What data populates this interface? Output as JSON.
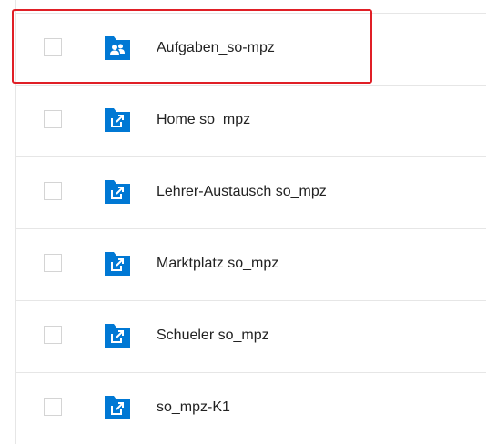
{
  "files": {
    "items": [
      {
        "name": "Aufgaben_so-mpz",
        "icon": "shared-folder-icon",
        "selected": false
      },
      {
        "name": "Home so_mpz",
        "icon": "linked-folder-icon",
        "selected": false
      },
      {
        "name": "Lehrer-Austausch so_mpz",
        "icon": "linked-folder-icon",
        "selected": false
      },
      {
        "name": "Marktplatz so_mpz",
        "icon": "linked-folder-icon",
        "selected": false
      },
      {
        "name": "Schueler so_mpz",
        "icon": "linked-folder-icon",
        "selected": false
      },
      {
        "name": "so_mpz-K1",
        "icon": "linked-folder-icon",
        "selected": false
      }
    ]
  },
  "colors": {
    "folder": "#0078d4",
    "highlight": "#e01f26",
    "divider": "#e6e6e6"
  }
}
